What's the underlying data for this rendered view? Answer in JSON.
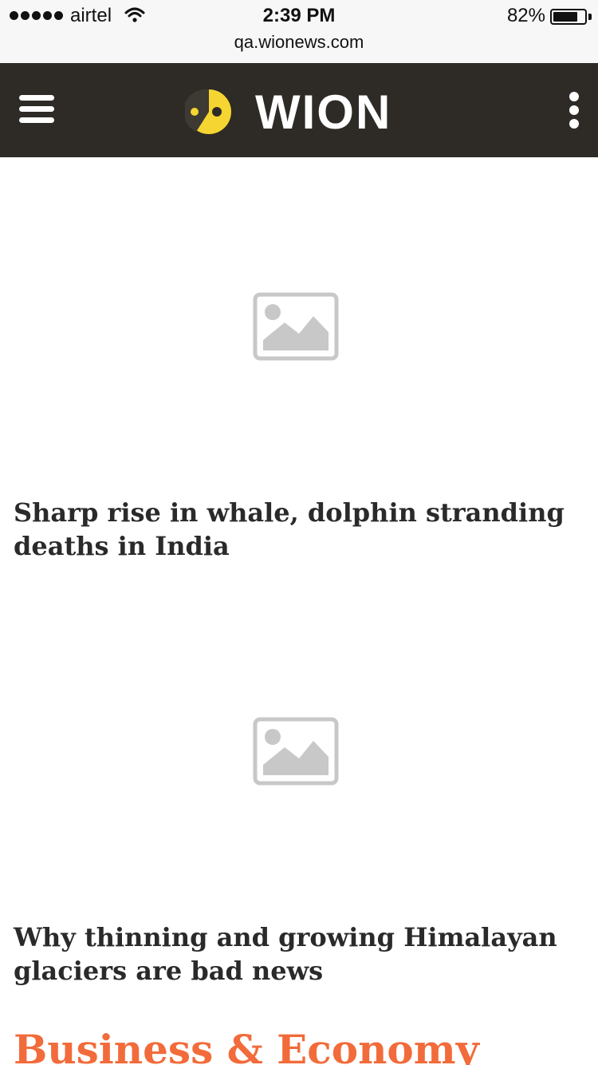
{
  "status_bar": {
    "carrier": "airtel",
    "time": "2:39 PM",
    "battery": "82%",
    "battery_level": 0.82
  },
  "browser": {
    "url": "qa.wionews.com"
  },
  "header": {
    "logo_text": "WION",
    "colors": {
      "background": "#2e2b26",
      "logo_yellow": "#f5d531"
    }
  },
  "articles": [
    {
      "title": "Sharp rise in whale, dolphin stranding deaths in India",
      "image": "image-placeholder-icon"
    },
    {
      "title": "Why thinning and growing Himalayan glaciers are bad news",
      "image": "image-placeholder-icon"
    }
  ],
  "section": {
    "title": "Business & Economy",
    "color": "#f26b3a"
  }
}
